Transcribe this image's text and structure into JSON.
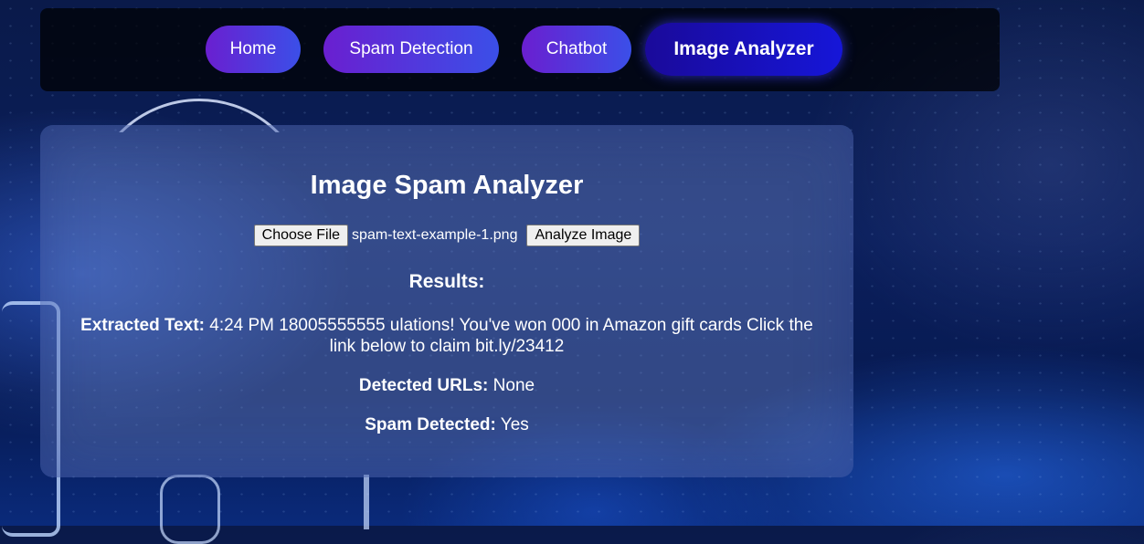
{
  "nav": {
    "items": [
      {
        "label": "Home"
      },
      {
        "label": "Spam Detection"
      },
      {
        "label": "Chatbot"
      },
      {
        "label": "Image Analyzer",
        "active": true
      }
    ]
  },
  "analyzer": {
    "title": "Image Spam Analyzer",
    "choose_file_label": "Choose File",
    "file_name": "spam-text-example-1.png",
    "analyze_button_label": "Analyze Image",
    "results_heading": "Results:",
    "extracted_text_label": "Extracted Text:",
    "extracted_text_value": "4:24 PM 18005555555 ulations! You've won 000 in Amazon gift cards Click the link below to claim bit.ly/23412",
    "detected_urls_label": "Detected URLs:",
    "detected_urls_value": "None",
    "spam_detected_label": "Spam Detected:",
    "spam_detected_value": "Yes"
  },
  "colors": {
    "nav_gradient_start": "#6a1fd0",
    "nav_gradient_end": "#3b4fe8",
    "active_nav": "#1616d8",
    "navbar_bg": "#000000"
  }
}
